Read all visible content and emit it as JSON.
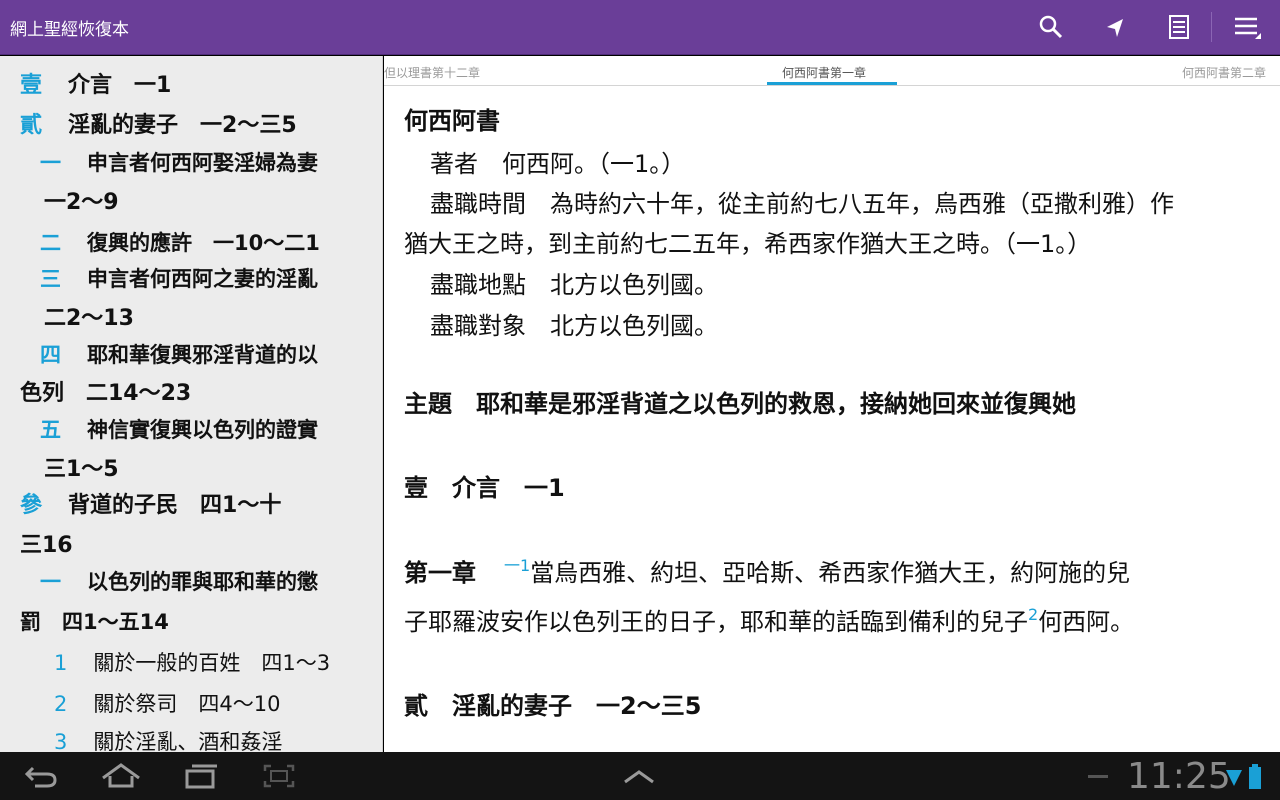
{
  "app": {
    "title": "網上聖經恢復本",
    "icons": [
      "search-icon",
      "share-icon",
      "notes-icon",
      "menu-icon"
    ]
  },
  "sidebar": {
    "items": [
      {
        "marker": "壹",
        "text": "介言　一1"
      },
      {
        "marker": "貳",
        "text": "淫亂的妻子　一2～三5"
      },
      {
        "marker": "一",
        "text": "申言者何西阿娶淫婦為妻"
      },
      {
        "marker": "",
        "text": "一2～9"
      },
      {
        "marker": "二",
        "text": "復興的應許　一10～二1"
      },
      {
        "marker": "三",
        "text": "申言者何西阿之妻的淫亂"
      },
      {
        "marker": "",
        "text": "二2～13"
      },
      {
        "marker": "四",
        "text": "耶和華復興邪淫背道的以"
      },
      {
        "marker": "",
        "text": "色列　二14～23"
      },
      {
        "marker": "五",
        "text": "神信實復興以色列的證實"
      },
      {
        "marker": "",
        "text": "三1～5"
      },
      {
        "marker": "參",
        "text": "背道的子民　四1～十"
      },
      {
        "marker": "",
        "text": "三16"
      },
      {
        "marker": "一",
        "text": "以色列的罪與耶和華的懲"
      },
      {
        "marker": "",
        "text": "罰　四1～五14"
      },
      {
        "marker": "1",
        "text": "關於一般的百姓　四1～3"
      },
      {
        "marker": "2",
        "text": "關於祭司　四4～10"
      },
      {
        "marker": "3",
        "text": "關於淫亂、酒和姦淫"
      }
    ]
  },
  "chapter_tabs": {
    "prev": "但以理書第十二章",
    "current": "何西阿書第一章",
    "next": "何西阿書第二章"
  },
  "content": {
    "book_title": "何西阿書",
    "author": "著者　何西阿。（一1。）",
    "time_1": "盡職時間　為時約六十年，從主前約七八五年，烏西雅（亞撒利雅）作",
    "time_2": "猶大王之時，到主前約七二五年，希西家作猶大王之時。（一1。）",
    "place": "盡職地點　北方以色列國。",
    "target": "盡職對象　北方以色列國。",
    "theme": "主題　耶和華是邪淫背道之以色列的救恩，接納她回來並復興她",
    "section_1": "壹　介言　一1",
    "chapter_label": "第一章",
    "verse_num": "一1",
    "verse_line1": "當烏西雅、約坦、亞哈斯、希西家作猶大王，約阿施的兒",
    "verse_line2": "子耶羅波安作以色列王的日子，耶和華的話臨到備利的兒子",
    "footnote_ref": "2",
    "verse_line2_end": "何西阿。",
    "section_2": "貳　淫亂的妻子　一2～三5"
  },
  "system_bar": {
    "time": "11:25",
    "buttons": [
      "back-icon",
      "home-icon",
      "recent-apps-icon",
      "screenshot-icon",
      "up-chevron-icon"
    ]
  },
  "colors": {
    "action_bar": "#6a3e98",
    "accent": "#1aa0d6",
    "sidebar_bg": "#ececec"
  }
}
